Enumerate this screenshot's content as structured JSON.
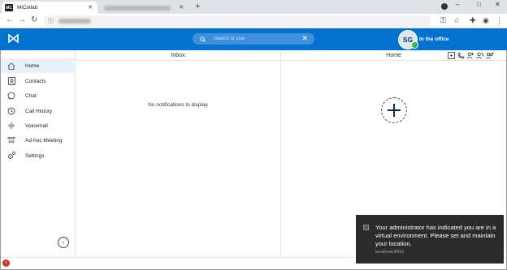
{
  "browser": {
    "active_tab_title": "MiCollab",
    "tab_favicon": "MC",
    "new_tab": "+",
    "window_controls": [
      "–",
      "□",
      "✕"
    ]
  },
  "app": {
    "logo_icon": "micollab-logo-icon",
    "search_placeholder": "Search or Dial",
    "user_initials": "SG",
    "user_status": "In the office",
    "presence_color": "#22b04b",
    "accent_color": "#0073d1"
  },
  "sidebar": {
    "items": [
      {
        "label": "Home",
        "icon": "home-icon",
        "active": true
      },
      {
        "label": "Contacts",
        "icon": "contacts-icon"
      },
      {
        "label": "Chat",
        "icon": "chat-icon"
      },
      {
        "label": "Call History",
        "icon": "clock-icon"
      },
      {
        "label": "Voicemail",
        "icon": "voicemail-icon"
      },
      {
        "label": "Ad-hoc Meeting",
        "icon": "meeting-icon"
      },
      {
        "label": "Settings",
        "icon": "gear-icon"
      }
    ]
  },
  "inbox": {
    "title": "Inbox",
    "empty_message": "No notifications to display"
  },
  "home": {
    "title": "Home"
  },
  "toast": {
    "message": "Your administrator has indicated you are in a virtual environment. Please set and maintain your location.",
    "source": "localhost:8431"
  },
  "footer": {
    "error_badge": "!"
  }
}
